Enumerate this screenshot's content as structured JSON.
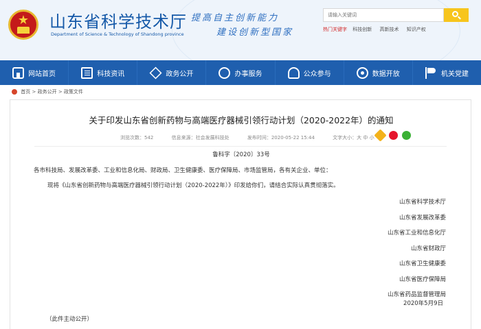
{
  "header": {
    "site_name": "山东省科学技术厅",
    "site_name_en": "Department of Science & Technology of Shandong province",
    "slogan_line1": "提高自主创新能力",
    "slogan_line2": "建设创新型国家",
    "search_placeholder": "请输入关键词",
    "hot_label": "热门关键字",
    "hot_items": [
      "科技创新",
      "高新技术",
      "知识产权"
    ]
  },
  "nav": {
    "items": [
      {
        "label": "网站首页",
        "icon": "home-icon"
      },
      {
        "label": "科技资讯",
        "icon": "news-icon"
      },
      {
        "label": "政务公开",
        "icon": "layers-icon"
      },
      {
        "label": "办事服务",
        "icon": "person-icon"
      },
      {
        "label": "公众参与",
        "icon": "people-icon"
      },
      {
        "label": "数据开放",
        "icon": "data-icon"
      },
      {
        "label": "机关党建",
        "icon": "party-flag-icon"
      }
    ]
  },
  "breadcrumb": {
    "items": [
      "首页",
      "政务公开",
      "政策文件"
    ],
    "separator": ">"
  },
  "article": {
    "title": "关于印发山东省创新药物与高端医疗器械引领行动计划（2020-2022年）的通知",
    "views": "浏览次数：542",
    "source": "信息来源：社会发展科技处",
    "date": "发布时间：2020-05-22 15:44",
    "font_size": "文字大小：大 中 小",
    "doc_number": "鲁科字〔2020〕33号",
    "addressees": "各市科技局、发展改革委、工业和信息化局、财政局、卫生健康委、医疗保障局、市场监管局，各有关企业、单位：",
    "body": "现将《山东省创新药物与高端医疗器械引领行动计划（2020-2022年）》印发给你们，请结合实际认真贯彻落实。",
    "signatories": [
      "山东省科学技术厅",
      "山东省发展改革委",
      "山东省工业和信息化厅",
      "山东省财政厅",
      "山东省卫生健康委",
      "山东省医疗保障局",
      "山东省药品监督管理局"
    ],
    "sign_date": "2020年5月9日",
    "disclosure": "（此件主动公开）"
  },
  "share": {
    "icons": [
      "qzone-icon",
      "weibo-icon",
      "wechat-icon"
    ]
  },
  "colors": {
    "nav_bg": "#1f5fae",
    "brand_blue": "#1559a8",
    "search_button": "#f7c51d",
    "hot_label": "#d32b2b"
  }
}
